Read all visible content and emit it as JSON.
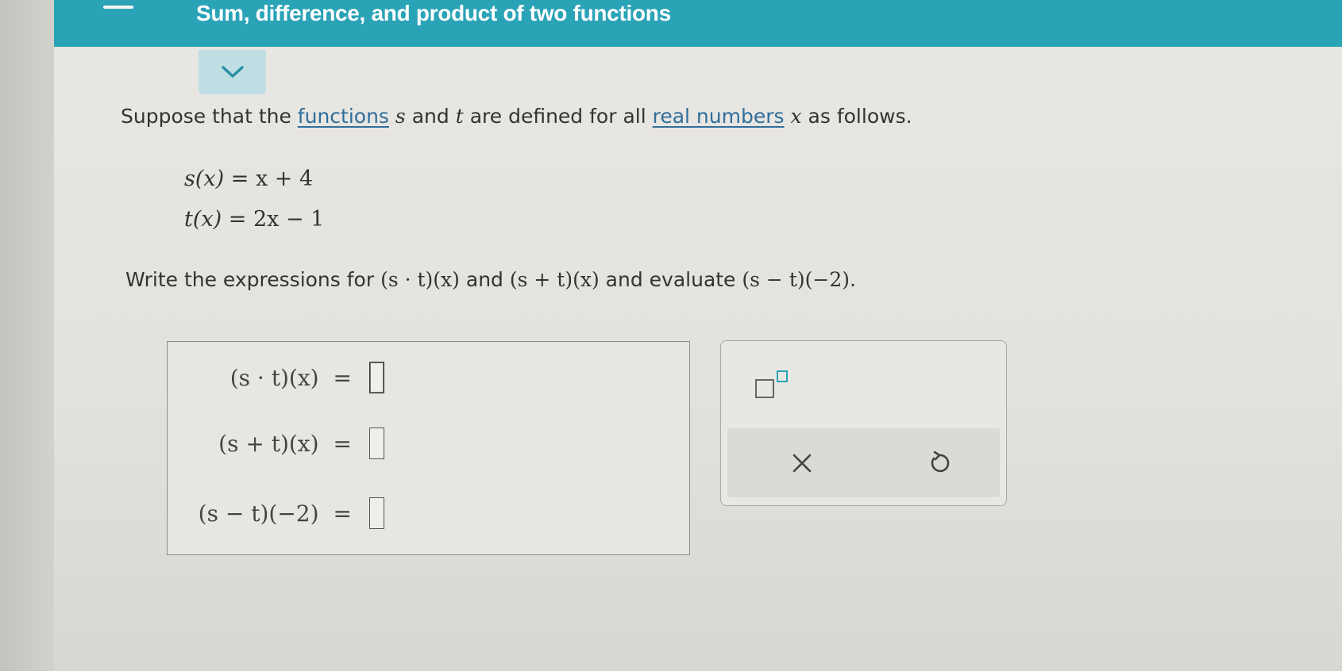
{
  "header": {
    "title": "Sum, difference, and product of two functions"
  },
  "question": {
    "prompt_before": "Suppose that the",
    "link_functions": "functions",
    "var_s": "s",
    "and_word": "and",
    "var_t": "t",
    "prompt_middle": "are defined for all",
    "link_real_numbers": "real numbers",
    "var_x": "x",
    "prompt_after": "as follows."
  },
  "definitions": [
    {
      "lhs": "s(x)",
      "rhs": "= x + 4"
    },
    {
      "lhs": "t(x)",
      "rhs": "= 2x − 1"
    }
  ],
  "instruction": {
    "text_start": "Write the expressions for",
    "expr1": "(s · t)(x)",
    "and1": "and",
    "expr2": "(s + t)(x)",
    "text_mid": "and evaluate",
    "expr3": "(s − t)(−2)",
    "period": "."
  },
  "answers": [
    {
      "label": "(s · t)(x)",
      "equals": "=",
      "value": ""
    },
    {
      "label": "(s + t)(x)",
      "equals": "=",
      "value": ""
    },
    {
      "label": "(s − t)(−2)",
      "equals": "=",
      "value": ""
    }
  ],
  "toolbox": {
    "exponent_icon": "superscript-template-icon",
    "clear_icon": "close-icon",
    "undo_icon": "undo-icon"
  },
  "colors": {
    "header_bg": "#2aa3b7",
    "collapse_tab_bg": "#bfdfe5",
    "link": "#2f6f9c",
    "page_bg": "#e9e7e3"
  }
}
